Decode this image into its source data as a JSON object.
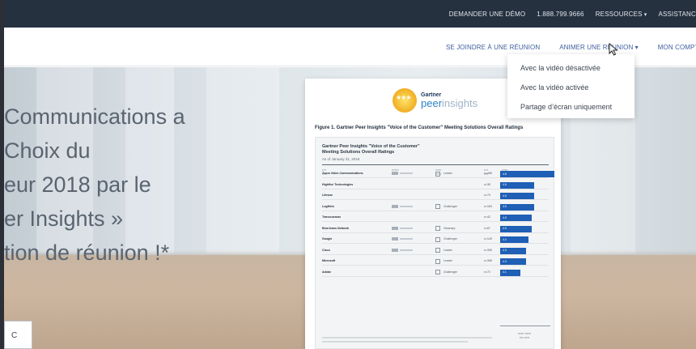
{
  "topbar": {
    "links": [
      {
        "label": "DEMANDER UNE DÉMO",
        "dropdown": false
      },
      {
        "label": "1.888.799.9666",
        "dropdown": false
      },
      {
        "label": "RESSOURCES",
        "dropdown": true
      },
      {
        "label": "ASSISTANC",
        "dropdown": false
      }
    ]
  },
  "nav": {
    "join_meeting": "SE JOINDRE À UNE RÉUNION",
    "host_meeting": "ANIMER UNE RÉUNION",
    "my_account": "MON COMPTE"
  },
  "dropdown": {
    "items": [
      "Avec la vidéo désactivée",
      "Avec la vidéo activée",
      "Partage d’écran uniquement"
    ]
  },
  "hero": {
    "lines": [
      "Communications a",
      "Choix du",
      "eur 2018 par le",
      "er Insights »",
      "tion de réunion !*"
    ]
  },
  "document": {
    "logo_gartner": "Gartner",
    "logo_peer": "peer",
    "logo_insights": "insights",
    "figure_title": "Figure 1. Gartner Peer Insights \"Voice of the Customer\" Meeting Solutions Overall Ratings",
    "panel_title_1": "Gartner Peer Insights \"Voice of the Customer\"",
    "panel_title_2": "Meeting Solutions Overall Ratings",
    "panel_date": "As of January 31, 2018",
    "vendors": [
      {
        "name": "Zoom Video Communications",
        "position": "Leader",
        "reviews": "n=496",
        "rating": "4.8",
        "share": 0.95,
        "mq": true
      },
      {
        "name": "Highfive Technologies",
        "position": "",
        "reviews": "n=35",
        "rating": "4.6",
        "share": 0.6,
        "mq": false
      },
      {
        "name": "Lifesize",
        "position": "",
        "reviews": "n=73",
        "rating": "4.6",
        "share": 0.6,
        "mq": false
      },
      {
        "name": "LogMeIn",
        "position": "Challenger",
        "reviews": "n=163",
        "rating": "4.6",
        "share": 0.6,
        "mq": true
      },
      {
        "name": "Transcosmos",
        "position": "",
        "reviews": "n=42",
        "rating": "4.5",
        "share": 0.55,
        "mq": false
      },
      {
        "name": "BlueJeans Network",
        "position": "Visionary",
        "reviews": "n=67",
        "rating": "4.5",
        "share": 0.55,
        "mq": true
      },
      {
        "name": "Google",
        "position": "Challenger",
        "reviews": "n=149",
        "rating": "4.4",
        "share": 0.5,
        "mq": true
      },
      {
        "name": "Cisco",
        "position": "Leader",
        "reviews": "n=305",
        "rating": "4.3",
        "share": 0.45,
        "mq": true
      },
      {
        "name": "Microsoft",
        "position": "Leader",
        "reviews": "n=396",
        "rating": "4.3",
        "share": 0.45,
        "mq": false
      },
      {
        "name": "Adobe",
        "position": "Challenger",
        "reviews": "n=72",
        "rating": "4.1",
        "share": 0.35,
        "mq": false
      }
    ]
  },
  "badge": "C",
  "colors": {
    "topbar": "#25313f",
    "nav_link": "#3f5f9e",
    "bar": "#1f5fb5"
  }
}
